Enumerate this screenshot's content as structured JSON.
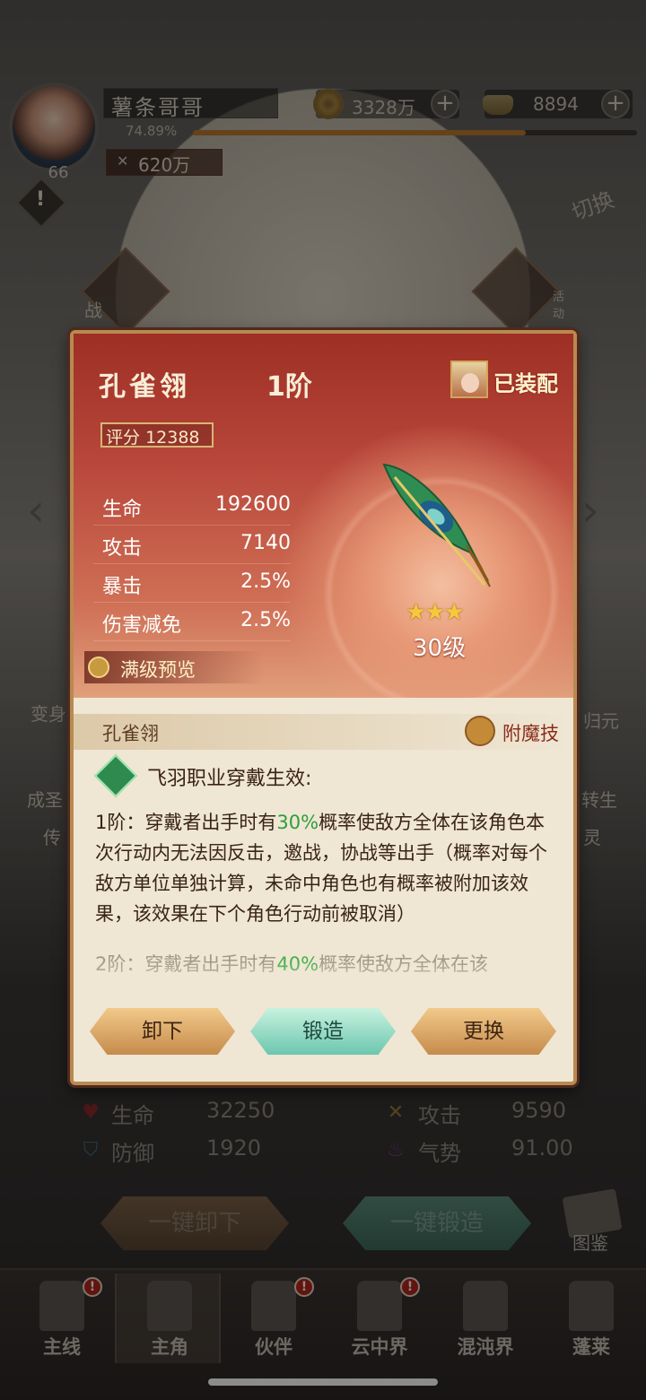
{
  "player": {
    "name": "薯条哥哥",
    "level": "66",
    "exp_percent": "74.89%",
    "exp_fraction": 0.7489,
    "power": "620万"
  },
  "currency": {
    "coins": "3328万",
    "ingots": "8894"
  },
  "buttons": {
    "plus": "+",
    "switch": "切换",
    "alert": "!"
  },
  "side": {
    "battle": "战",
    "event": "活动",
    "transform": "变身",
    "ascend": "成圣",
    "reunite": "归元",
    "rebirth": "转生",
    "legend": "传",
    "spirit": "灵"
  },
  "dialog": {
    "item_name": "孔雀翎",
    "rank": "1阶",
    "equipped": "已装配",
    "score_label": "评分",
    "score": "12388",
    "stats": [
      {
        "name": "生命",
        "value": "192600"
      },
      {
        "name": "攻击",
        "value": "7140"
      },
      {
        "name": "暴击",
        "value": "2.5%"
      },
      {
        "name": "伤害减免",
        "value": "2.5%"
      }
    ],
    "preview": "满级预览",
    "stars": "★★★",
    "star_count": 3,
    "item_level": "30级",
    "section_title": "孔雀翎",
    "enchant": "附魔技",
    "skill_header": "飞羽职业穿戴生效:",
    "skill_rank1_a": "1阶：穿戴者出手时有",
    "skill_rank1_pct": "30%",
    "skill_rank1_b": "概率使敌方全体在该角色本次行动内无法因反击，邀战，协战等出手（概率对每个敌方单位单独计算，未命中角色也有概率被附加该效果，该效果在下个角色行动前被取消）",
    "skill_rank2_a": "2阶：穿戴者出手时有",
    "skill_rank2_pct": "40%",
    "skill_rank2_b": "概率使敌方全体在该",
    "unequip": "卸下",
    "forge": "锻造",
    "replace": "更换"
  },
  "hero_stats": {
    "hp_label": "生命",
    "hp": "32250",
    "atk_label": "攻击",
    "atk": "9590",
    "def_label": "防御",
    "def": "1920",
    "aura_label": "气势",
    "aura": "91.00"
  },
  "actions": {
    "unequip_all": "一键卸下",
    "forge_all": "一键锻造",
    "atlas": "图鉴"
  },
  "nav": [
    {
      "label": "主线",
      "badge": "!"
    },
    {
      "label": "主角",
      "badge": ""
    },
    {
      "label": "伙伴",
      "badge": "!"
    },
    {
      "label": "云中界",
      "badge": "!"
    },
    {
      "label": "混沌界",
      "badge": ""
    },
    {
      "label": "蓬莱",
      "badge": ""
    }
  ]
}
